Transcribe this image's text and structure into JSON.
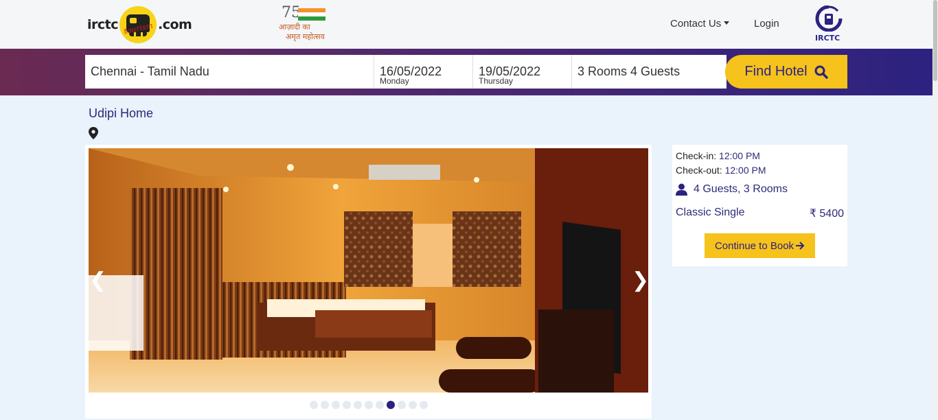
{
  "header": {
    "logo_left_text": "irctc",
    "logo_right_text": ".com",
    "logo_badge_text": "tourism",
    "azadi_number": "75",
    "azadi_line1": "आज़ादी का",
    "azadi_line2": "अमृत महोत्सव",
    "contact_label": "Contact Us",
    "login_label": "Login",
    "irctc_badge_label": "IRCTC"
  },
  "search": {
    "city": "Chennai - Tamil Nadu",
    "checkin_date": "16/05/2022",
    "checkin_day": "Monday",
    "checkout_date": "19/05/2022",
    "checkout_day": "Thursday",
    "guests": "3 Rooms 4 Guests",
    "find_label": "Find Hotel"
  },
  "hotel": {
    "name": "Udipi Home"
  },
  "gallery": {
    "prev_label": "❮",
    "next_label": "❯",
    "dot_count": 11,
    "active_index": 7
  },
  "booking": {
    "checkin_label": "Check-in:",
    "checkin_time": "12:00 PM",
    "checkout_label": "Check-out:",
    "checkout_time": "12:00 PM",
    "guests_rooms": "4 Guests, 3 Rooms",
    "room_type": "Classic Single",
    "price": "₹ 5400",
    "continue_label": "Continue to Book"
  },
  "colors": {
    "brand_navy": "#2c2280",
    "accent_yellow": "#f6c21c",
    "band_start": "#6a2a52",
    "band_end": "#2c2280",
    "page_bg": "#eaf2fb"
  }
}
